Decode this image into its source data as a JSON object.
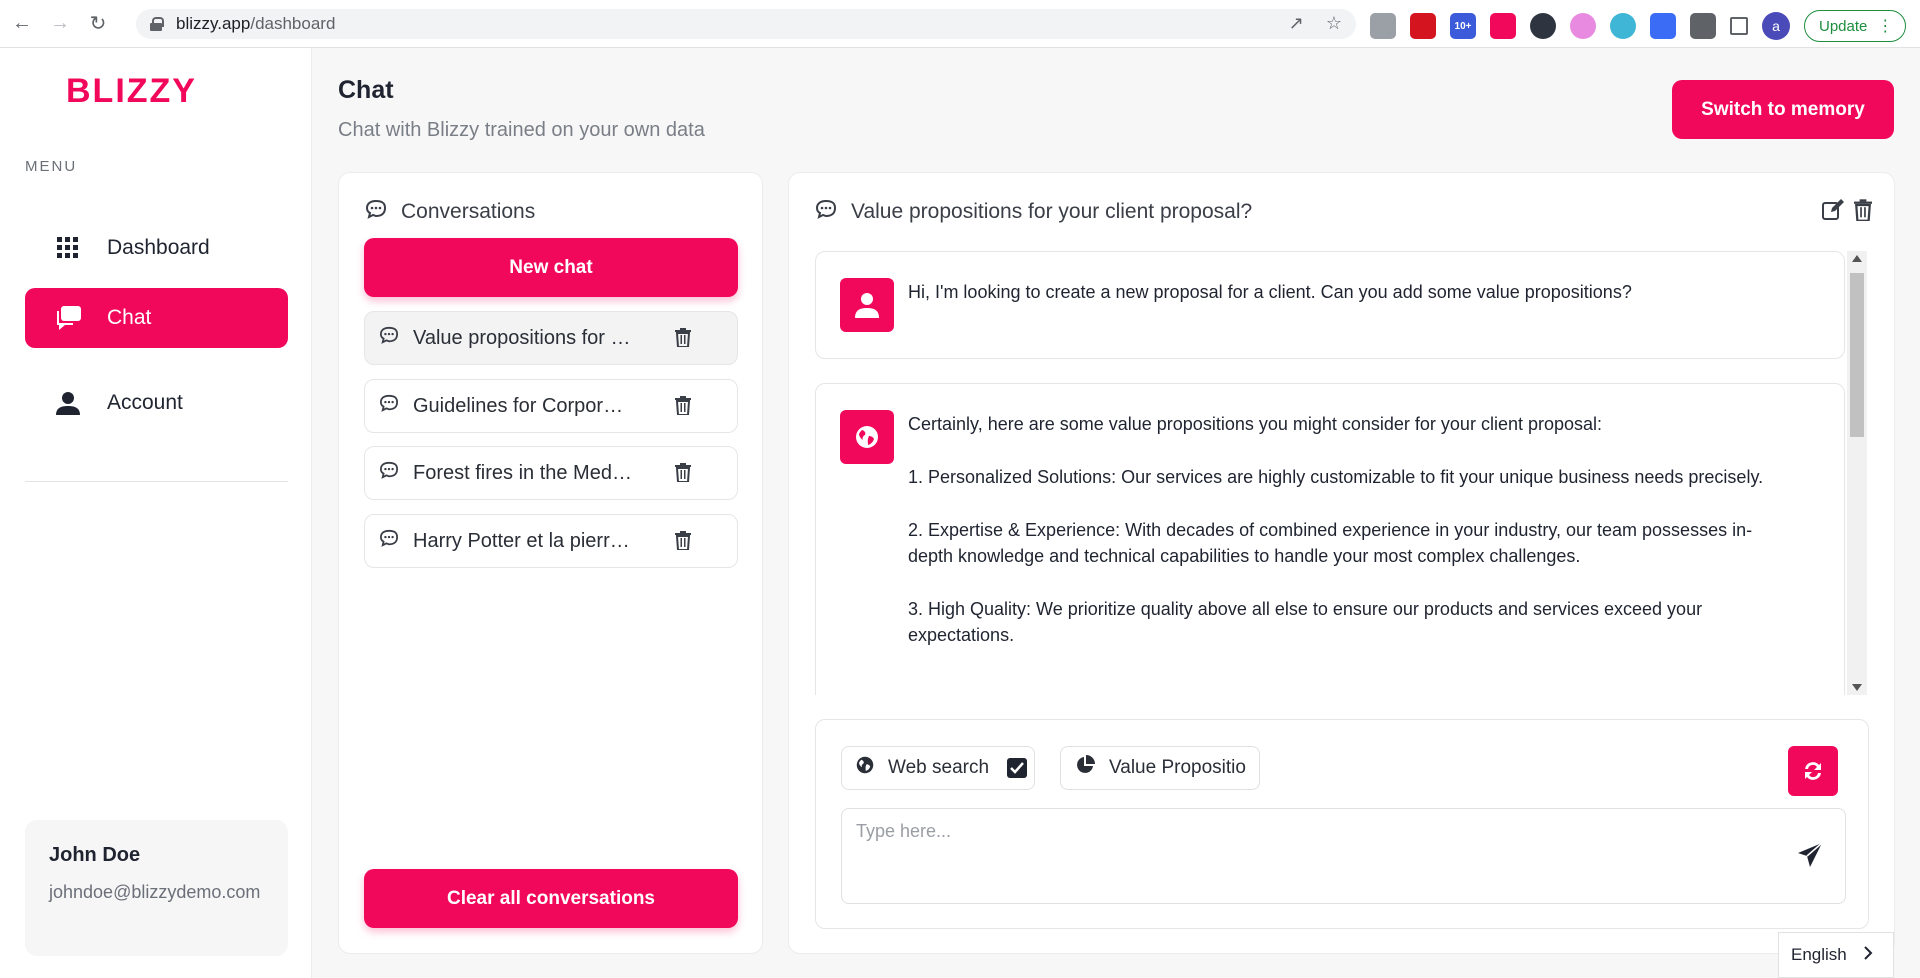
{
  "browser": {
    "url_host": "blizzy.app",
    "url_path": "/dashboard",
    "update_label": "Update",
    "profile_initial": "a",
    "extension_badge": "10+"
  },
  "sidebar": {
    "logo_text": "BLIZZY",
    "menu_label": "MENU",
    "items": [
      {
        "label": "Dashboard",
        "icon": "grid-icon"
      },
      {
        "label": "Chat",
        "icon": "chat-icon"
      },
      {
        "label": "Account",
        "icon": "person-icon"
      }
    ],
    "user": {
      "name": "John Doe",
      "email": "johndoe@blizzydemo.com"
    }
  },
  "header": {
    "title": "Chat",
    "subtitle": "Chat with Blizzy trained on your own data",
    "memory_button": "Switch to memory"
  },
  "conversations": {
    "title": "Conversations",
    "new_chat_label": "New chat",
    "clear_label": "Clear all conversations",
    "items": [
      {
        "label": "Value propositions for your client proposal?"
      },
      {
        "label": "Guidelines for Corporate communication"
      },
      {
        "label": "Forest fires in the Mediterranean"
      },
      {
        "label": "Harry Potter et la pierre philosophale"
      }
    ]
  },
  "chat": {
    "title": "Value propositions for your client proposal?",
    "messages": [
      {
        "role": "user",
        "paragraphs": [
          "Hi, I'm looking to create a new proposal for a client. Can you add some value propositions?"
        ]
      },
      {
        "role": "assistant",
        "paragraphs": [
          "Certainly, here are some value propositions you might consider for your client proposal:",
          "1. Personalized Solutions: Our services are highly customizable to fit your unique business needs precisely.",
          "2. Expertise & Experience: With decades of combined experience in your industry, our team possesses in-depth knowledge and technical capabilities to handle your most complex challenges.",
          "3. High Quality: We prioritize quality above all else to ensure our products and services exceed your expectations."
        ]
      }
    ],
    "web_search_label": "Web search",
    "web_search_checked": true,
    "source_label": "Value Propositio",
    "input_placeholder": "Type here..."
  },
  "language": {
    "selected": "English"
  },
  "colors": {
    "accent": "#f2085a",
    "text": "#1f2430",
    "muted": "#7a7e86"
  }
}
